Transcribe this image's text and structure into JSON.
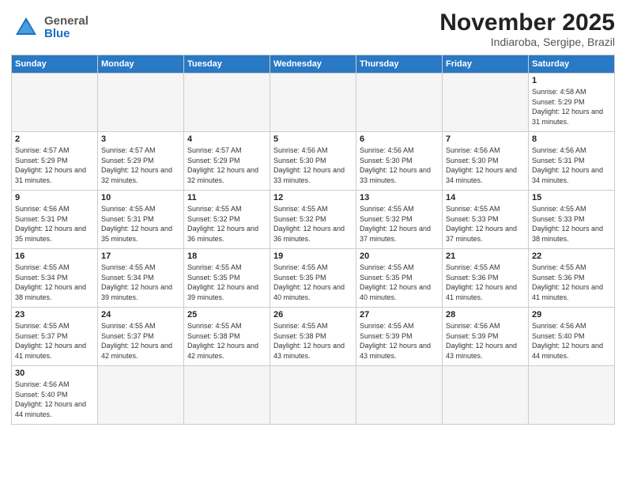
{
  "header": {
    "logo_general": "General",
    "logo_blue": "Blue",
    "main_title": "November 2025",
    "subtitle": "Indiaroba, Sergipe, Brazil"
  },
  "calendar": {
    "days_of_week": [
      "Sunday",
      "Monday",
      "Tuesday",
      "Wednesday",
      "Thursday",
      "Friday",
      "Saturday"
    ],
    "weeks": [
      [
        {
          "day": "",
          "info": ""
        },
        {
          "day": "",
          "info": ""
        },
        {
          "day": "",
          "info": ""
        },
        {
          "day": "",
          "info": ""
        },
        {
          "day": "",
          "info": ""
        },
        {
          "day": "",
          "info": ""
        },
        {
          "day": "1",
          "info": "Sunrise: 4:58 AM\nSunset: 5:29 PM\nDaylight: 12 hours and 31 minutes."
        }
      ],
      [
        {
          "day": "2",
          "info": "Sunrise: 4:57 AM\nSunset: 5:29 PM\nDaylight: 12 hours and 31 minutes."
        },
        {
          "day": "3",
          "info": "Sunrise: 4:57 AM\nSunset: 5:29 PM\nDaylight: 12 hours and 32 minutes."
        },
        {
          "day": "4",
          "info": "Sunrise: 4:57 AM\nSunset: 5:29 PM\nDaylight: 12 hours and 32 minutes."
        },
        {
          "day": "5",
          "info": "Sunrise: 4:56 AM\nSunset: 5:30 PM\nDaylight: 12 hours and 33 minutes."
        },
        {
          "day": "6",
          "info": "Sunrise: 4:56 AM\nSunset: 5:30 PM\nDaylight: 12 hours and 33 minutes."
        },
        {
          "day": "7",
          "info": "Sunrise: 4:56 AM\nSunset: 5:30 PM\nDaylight: 12 hours and 34 minutes."
        },
        {
          "day": "8",
          "info": "Sunrise: 4:56 AM\nSunset: 5:31 PM\nDaylight: 12 hours and 34 minutes."
        }
      ],
      [
        {
          "day": "9",
          "info": "Sunrise: 4:56 AM\nSunset: 5:31 PM\nDaylight: 12 hours and 35 minutes."
        },
        {
          "day": "10",
          "info": "Sunrise: 4:55 AM\nSunset: 5:31 PM\nDaylight: 12 hours and 35 minutes."
        },
        {
          "day": "11",
          "info": "Sunrise: 4:55 AM\nSunset: 5:32 PM\nDaylight: 12 hours and 36 minutes."
        },
        {
          "day": "12",
          "info": "Sunrise: 4:55 AM\nSunset: 5:32 PM\nDaylight: 12 hours and 36 minutes."
        },
        {
          "day": "13",
          "info": "Sunrise: 4:55 AM\nSunset: 5:32 PM\nDaylight: 12 hours and 37 minutes."
        },
        {
          "day": "14",
          "info": "Sunrise: 4:55 AM\nSunset: 5:33 PM\nDaylight: 12 hours and 37 minutes."
        },
        {
          "day": "15",
          "info": "Sunrise: 4:55 AM\nSunset: 5:33 PM\nDaylight: 12 hours and 38 minutes."
        }
      ],
      [
        {
          "day": "16",
          "info": "Sunrise: 4:55 AM\nSunset: 5:34 PM\nDaylight: 12 hours and 38 minutes."
        },
        {
          "day": "17",
          "info": "Sunrise: 4:55 AM\nSunset: 5:34 PM\nDaylight: 12 hours and 39 minutes."
        },
        {
          "day": "18",
          "info": "Sunrise: 4:55 AM\nSunset: 5:35 PM\nDaylight: 12 hours and 39 minutes."
        },
        {
          "day": "19",
          "info": "Sunrise: 4:55 AM\nSunset: 5:35 PM\nDaylight: 12 hours and 40 minutes."
        },
        {
          "day": "20",
          "info": "Sunrise: 4:55 AM\nSunset: 5:35 PM\nDaylight: 12 hours and 40 minutes."
        },
        {
          "day": "21",
          "info": "Sunrise: 4:55 AM\nSunset: 5:36 PM\nDaylight: 12 hours and 41 minutes."
        },
        {
          "day": "22",
          "info": "Sunrise: 4:55 AM\nSunset: 5:36 PM\nDaylight: 12 hours and 41 minutes."
        }
      ],
      [
        {
          "day": "23",
          "info": "Sunrise: 4:55 AM\nSunset: 5:37 PM\nDaylight: 12 hours and 41 minutes."
        },
        {
          "day": "24",
          "info": "Sunrise: 4:55 AM\nSunset: 5:37 PM\nDaylight: 12 hours and 42 minutes."
        },
        {
          "day": "25",
          "info": "Sunrise: 4:55 AM\nSunset: 5:38 PM\nDaylight: 12 hours and 42 minutes."
        },
        {
          "day": "26",
          "info": "Sunrise: 4:55 AM\nSunset: 5:38 PM\nDaylight: 12 hours and 43 minutes."
        },
        {
          "day": "27",
          "info": "Sunrise: 4:55 AM\nSunset: 5:39 PM\nDaylight: 12 hours and 43 minutes."
        },
        {
          "day": "28",
          "info": "Sunrise: 4:56 AM\nSunset: 5:39 PM\nDaylight: 12 hours and 43 minutes."
        },
        {
          "day": "29",
          "info": "Sunrise: 4:56 AM\nSunset: 5:40 PM\nDaylight: 12 hours and 44 minutes."
        }
      ],
      [
        {
          "day": "30",
          "info": "Sunrise: 4:56 AM\nSunset: 5:40 PM\nDaylight: 12 hours and 44 minutes."
        },
        {
          "day": "",
          "info": ""
        },
        {
          "day": "",
          "info": ""
        },
        {
          "day": "",
          "info": ""
        },
        {
          "day": "",
          "info": ""
        },
        {
          "day": "",
          "info": ""
        },
        {
          "day": "",
          "info": ""
        }
      ]
    ]
  }
}
